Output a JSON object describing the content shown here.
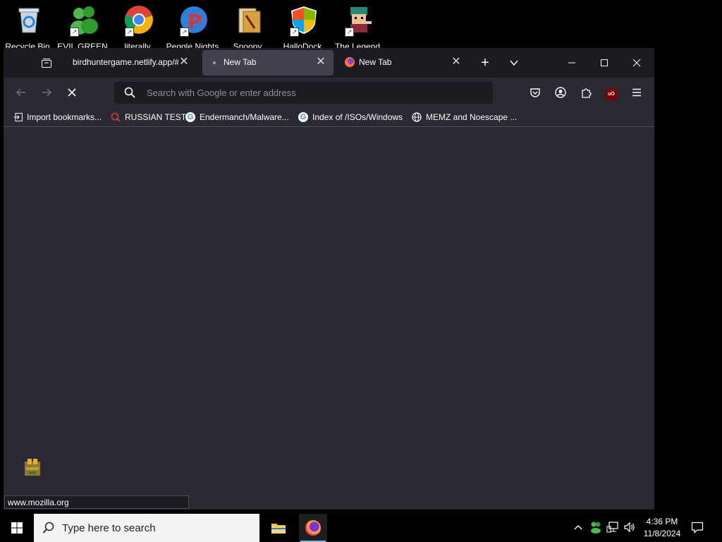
{
  "desktop": {
    "icons": [
      {
        "label": "Recycle Bin",
        "icon": "recycle-bin-icon"
      },
      {
        "label": "EVIL GREEN",
        "icon": "messenger-people-icon"
      },
      {
        "label": "literally",
        "icon": "chrome-icon"
      },
      {
        "label": "Peggle Nights",
        "icon": "peggle-icon"
      },
      {
        "label": "Spoopy",
        "icon": "folder-document-icon"
      },
      {
        "label": "HalloDock",
        "icon": "shield-icon"
      },
      {
        "label": "The Legend",
        "icon": "pixel-character-icon"
      }
    ]
  },
  "browser": {
    "tabs": [
      {
        "title": "birdhuntergame.netlify.app/#",
        "active": false
      },
      {
        "title": "New Tab",
        "active": true
      },
      {
        "title": "New Tab",
        "active": false
      }
    ],
    "url_placeholder": "Search with Google or enter address",
    "bookmarks": [
      {
        "label": "Import bookmarks...",
        "icon": "import-icon"
      },
      {
        "label": "RUSSIAN TEST",
        "icon": "search-red-icon"
      },
      {
        "label": "Endermanch/Malware...",
        "icon": "google-icon"
      },
      {
        "label": "Index of /ISOs/Windows",
        "icon": "google-icon"
      },
      {
        "label": "MEMZ and Noescape ...",
        "icon": "globe-icon"
      }
    ],
    "status_text": "www.mozilla.org",
    "ublock_badge": "uO"
  },
  "taskbar": {
    "search_placeholder": "Type here to search",
    "time": "4:36 PM",
    "date": "11/8/2024"
  },
  "colors": {
    "window_bg": "#2b2a33",
    "tabbar_bg": "#1c1b22",
    "active_tab": "#42414d",
    "accent_ublock": "#800000"
  }
}
